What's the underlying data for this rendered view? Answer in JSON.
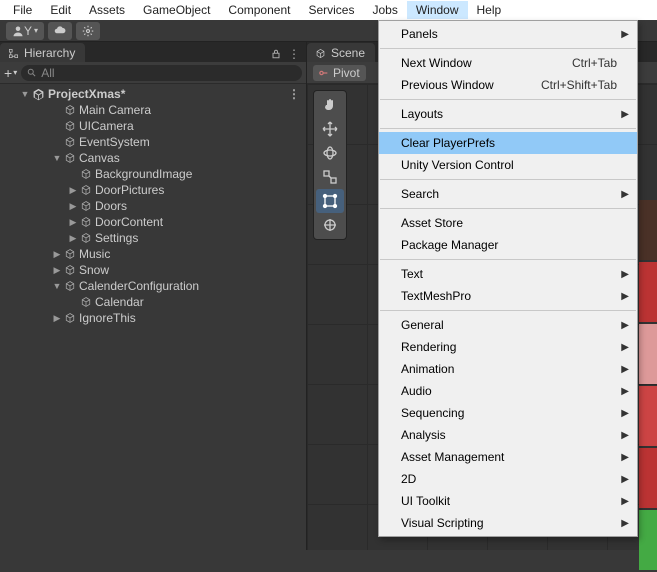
{
  "menubar": [
    "File",
    "Edit",
    "Assets",
    "GameObject",
    "Component",
    "Services",
    "Jobs",
    "Window",
    "Help"
  ],
  "menubar_active_index": 7,
  "toolbar": {
    "account": "Y"
  },
  "hierarchy": {
    "tab": "Hierarchy",
    "search_placeholder": "All",
    "scene": "ProjectXmas*",
    "nodes": [
      {
        "depth": 1,
        "twist": "",
        "label": "Main Camera"
      },
      {
        "depth": 1,
        "twist": "",
        "label": "UICamera"
      },
      {
        "depth": 1,
        "twist": "",
        "label": "EventSystem"
      },
      {
        "depth": 1,
        "twist": "down",
        "label": "Canvas"
      },
      {
        "depth": 2,
        "twist": "",
        "label": "BackgroundImage"
      },
      {
        "depth": 2,
        "twist": "right",
        "label": "DoorPictures"
      },
      {
        "depth": 2,
        "twist": "right",
        "label": "Doors"
      },
      {
        "depth": 2,
        "twist": "right",
        "label": "DoorContent"
      },
      {
        "depth": 2,
        "twist": "right",
        "label": "Settings"
      },
      {
        "depth": 1,
        "twist": "right",
        "label": "Music"
      },
      {
        "depth": 1,
        "twist": "right",
        "label": "Snow"
      },
      {
        "depth": 1,
        "twist": "down",
        "label": "CalenderConfiguration"
      },
      {
        "depth": 2,
        "twist": "",
        "label": "Calendar"
      },
      {
        "depth": 1,
        "twist": "right",
        "label": "IgnoreThis"
      }
    ]
  },
  "scene_panel": {
    "tab": "Scene",
    "pivot_label": "Pivot"
  },
  "dropdown": [
    {
      "type": "item",
      "label": "Panels",
      "submenu": true
    },
    {
      "type": "sep"
    },
    {
      "type": "item",
      "label": "Next Window",
      "shortcut": "Ctrl+Tab"
    },
    {
      "type": "item",
      "label": "Previous Window",
      "shortcut": "Ctrl+Shift+Tab"
    },
    {
      "type": "sep"
    },
    {
      "type": "item",
      "label": "Layouts",
      "submenu": true
    },
    {
      "type": "sep"
    },
    {
      "type": "item",
      "label": "Clear PlayerPrefs",
      "highlight": true
    },
    {
      "type": "item",
      "label": "Unity Version Control"
    },
    {
      "type": "sep"
    },
    {
      "type": "item",
      "label": "Search",
      "submenu": true
    },
    {
      "type": "sep"
    },
    {
      "type": "item",
      "label": "Asset Store"
    },
    {
      "type": "item",
      "label": "Package Manager"
    },
    {
      "type": "sep"
    },
    {
      "type": "item",
      "label": "Text",
      "submenu": true
    },
    {
      "type": "item",
      "label": "TextMeshPro",
      "submenu": true
    },
    {
      "type": "sep"
    },
    {
      "type": "item",
      "label": "General",
      "submenu": true
    },
    {
      "type": "item",
      "label": "Rendering",
      "submenu": true
    },
    {
      "type": "item",
      "label": "Animation",
      "submenu": true
    },
    {
      "type": "item",
      "label": "Audio",
      "submenu": true
    },
    {
      "type": "item",
      "label": "Sequencing",
      "submenu": true
    },
    {
      "type": "item",
      "label": "Analysis",
      "submenu": true
    },
    {
      "type": "item",
      "label": "Asset Management",
      "submenu": true
    },
    {
      "type": "item",
      "label": "2D",
      "submenu": true
    },
    {
      "type": "item",
      "label": "UI Toolkit",
      "submenu": true
    },
    {
      "type": "item",
      "label": "Visual Scripting",
      "submenu": true
    }
  ]
}
